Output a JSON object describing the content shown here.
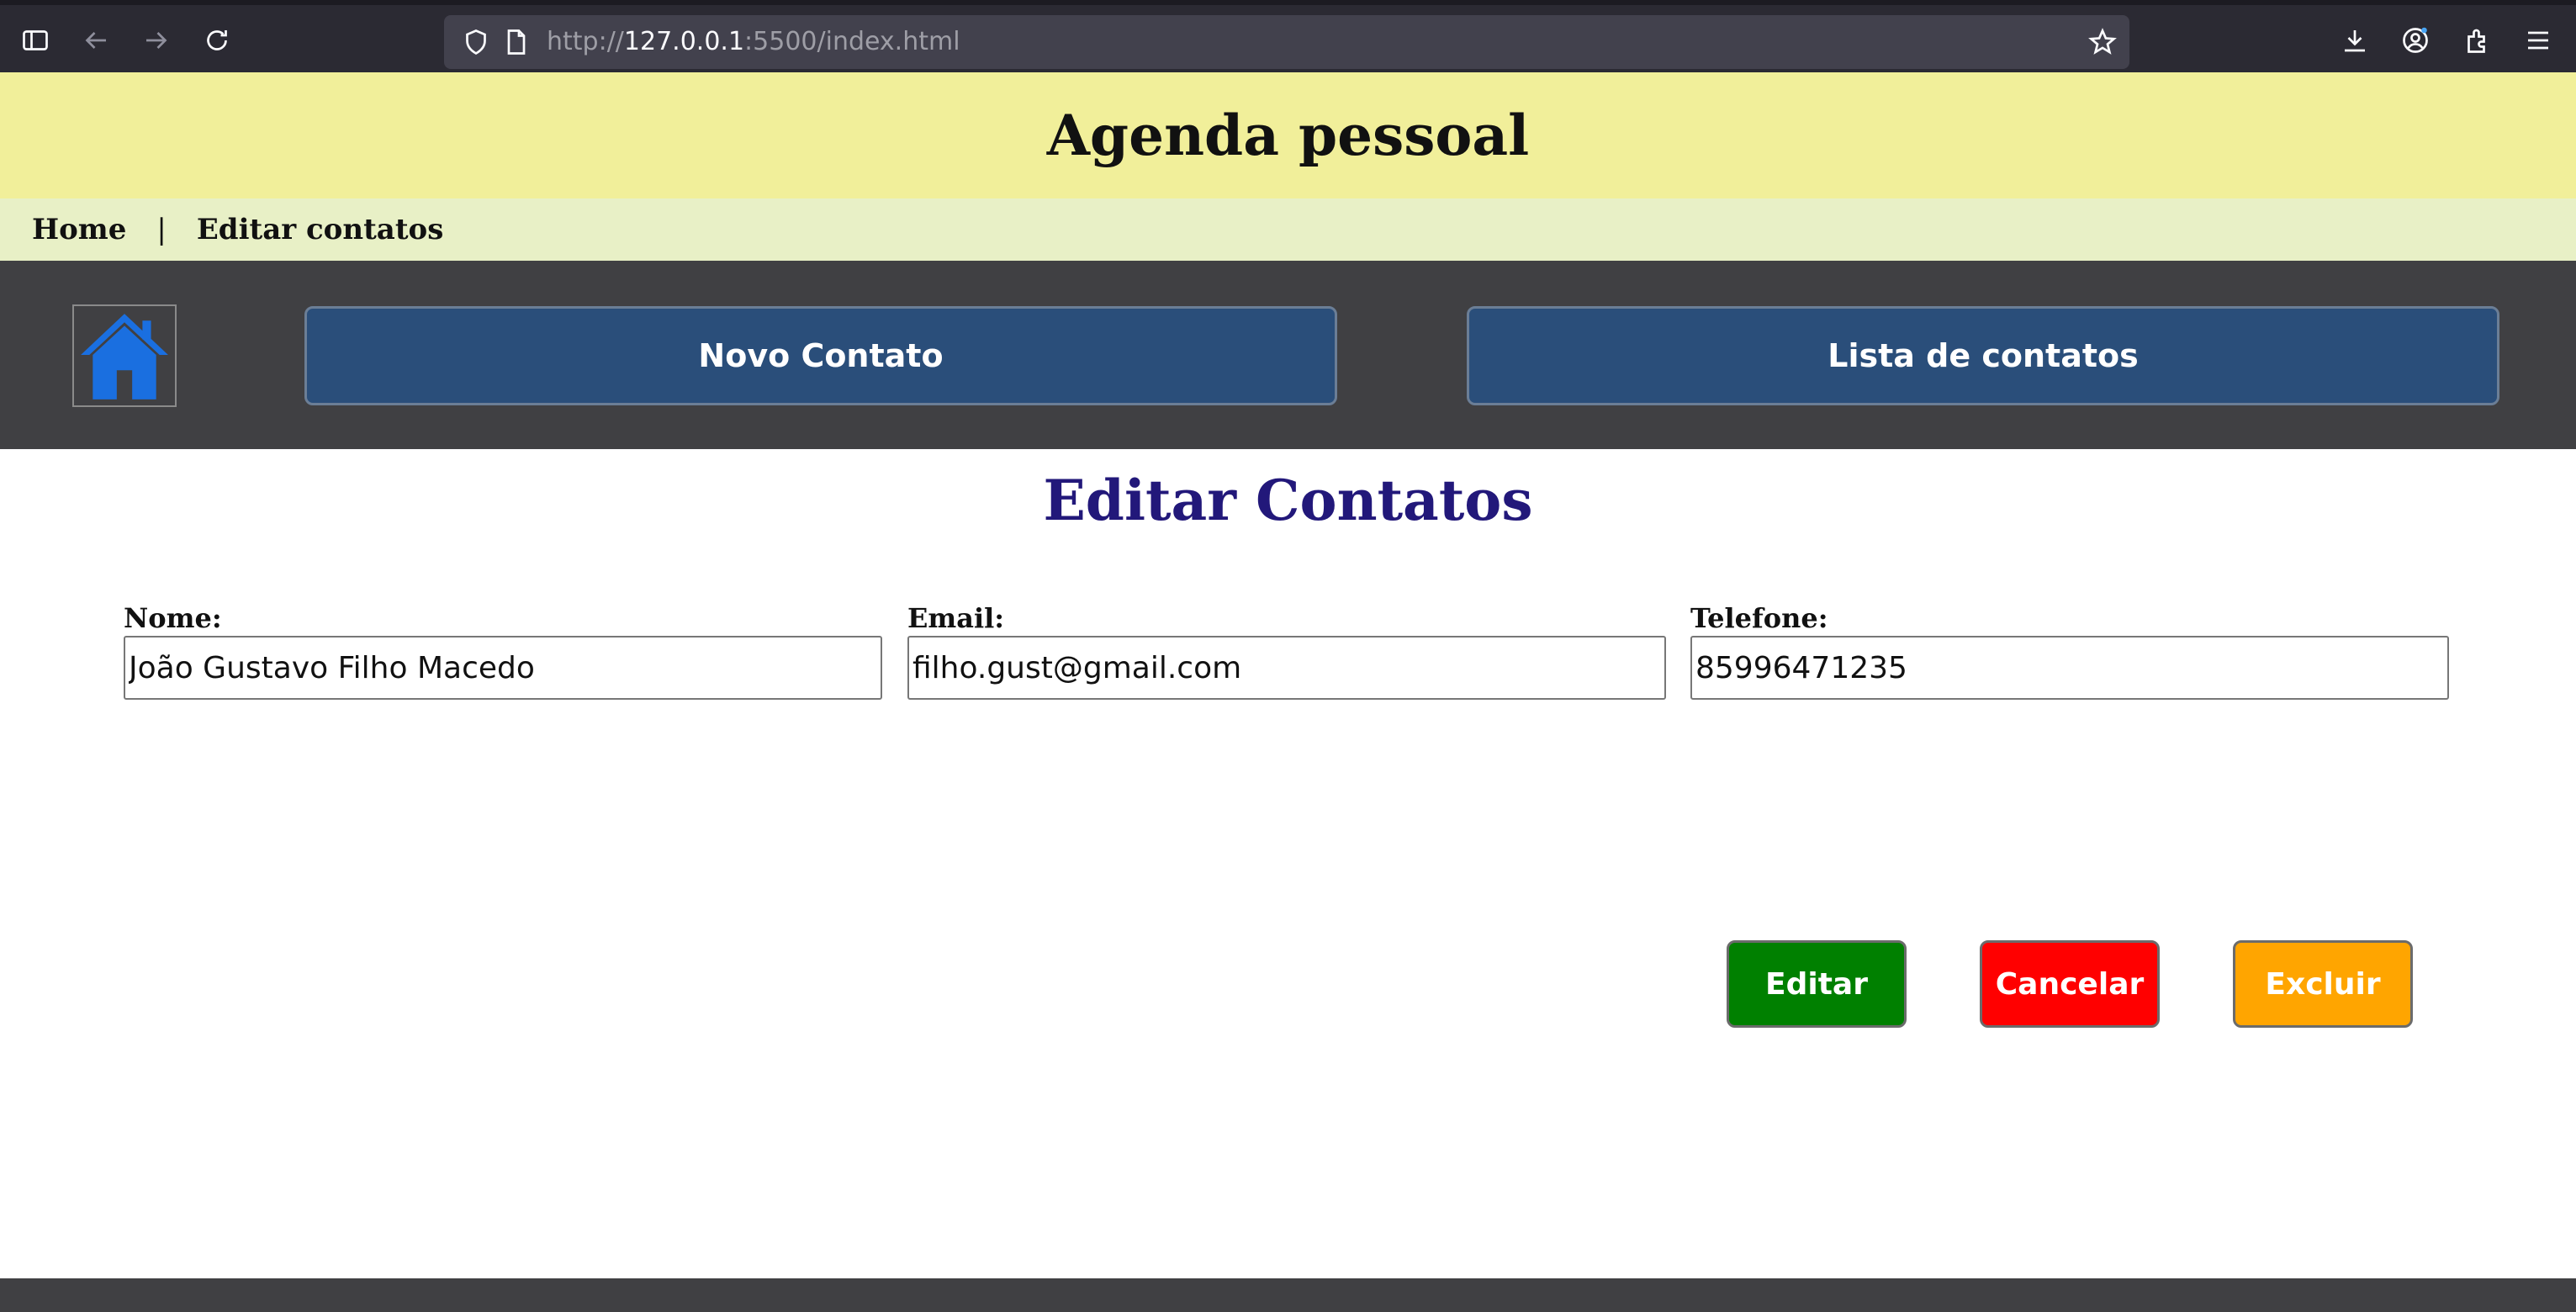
{
  "browser": {
    "url_prefix": "http://",
    "url_host": "127.0.0.1",
    "url_rest": ":5500/index.html"
  },
  "header": {
    "title": "Agenda pessoal"
  },
  "breadcrumb": {
    "home": "Home",
    "separator": "|",
    "current": "Editar contatos"
  },
  "nav": {
    "home_icon": "house-icon",
    "new_contact": "Novo Contato",
    "contact_list": "Lista de contatos"
  },
  "main": {
    "title": "Editar Contatos",
    "fields": [
      {
        "label": "Nome:",
        "value": "João Gustavo Filho Macedo"
      },
      {
        "label": "Email:",
        "value": "filho.gust@gmail.com"
      },
      {
        "label": "Telefone:",
        "value": "85996471235"
      }
    ],
    "actions": {
      "edit": "Editar",
      "cancel": "Cancelar",
      "delete": "Excluir"
    }
  },
  "colors": {
    "header_bg": "#f1ef9a",
    "breadcrumb_bg": "#e8f0c6",
    "nav_bg": "#404043",
    "nav_button": "#2a4e7a",
    "title": "#22187a",
    "edit": "#008000",
    "cancel": "#ff0000",
    "delete": "#ffa500",
    "home_icon": "#1a6fe0"
  }
}
